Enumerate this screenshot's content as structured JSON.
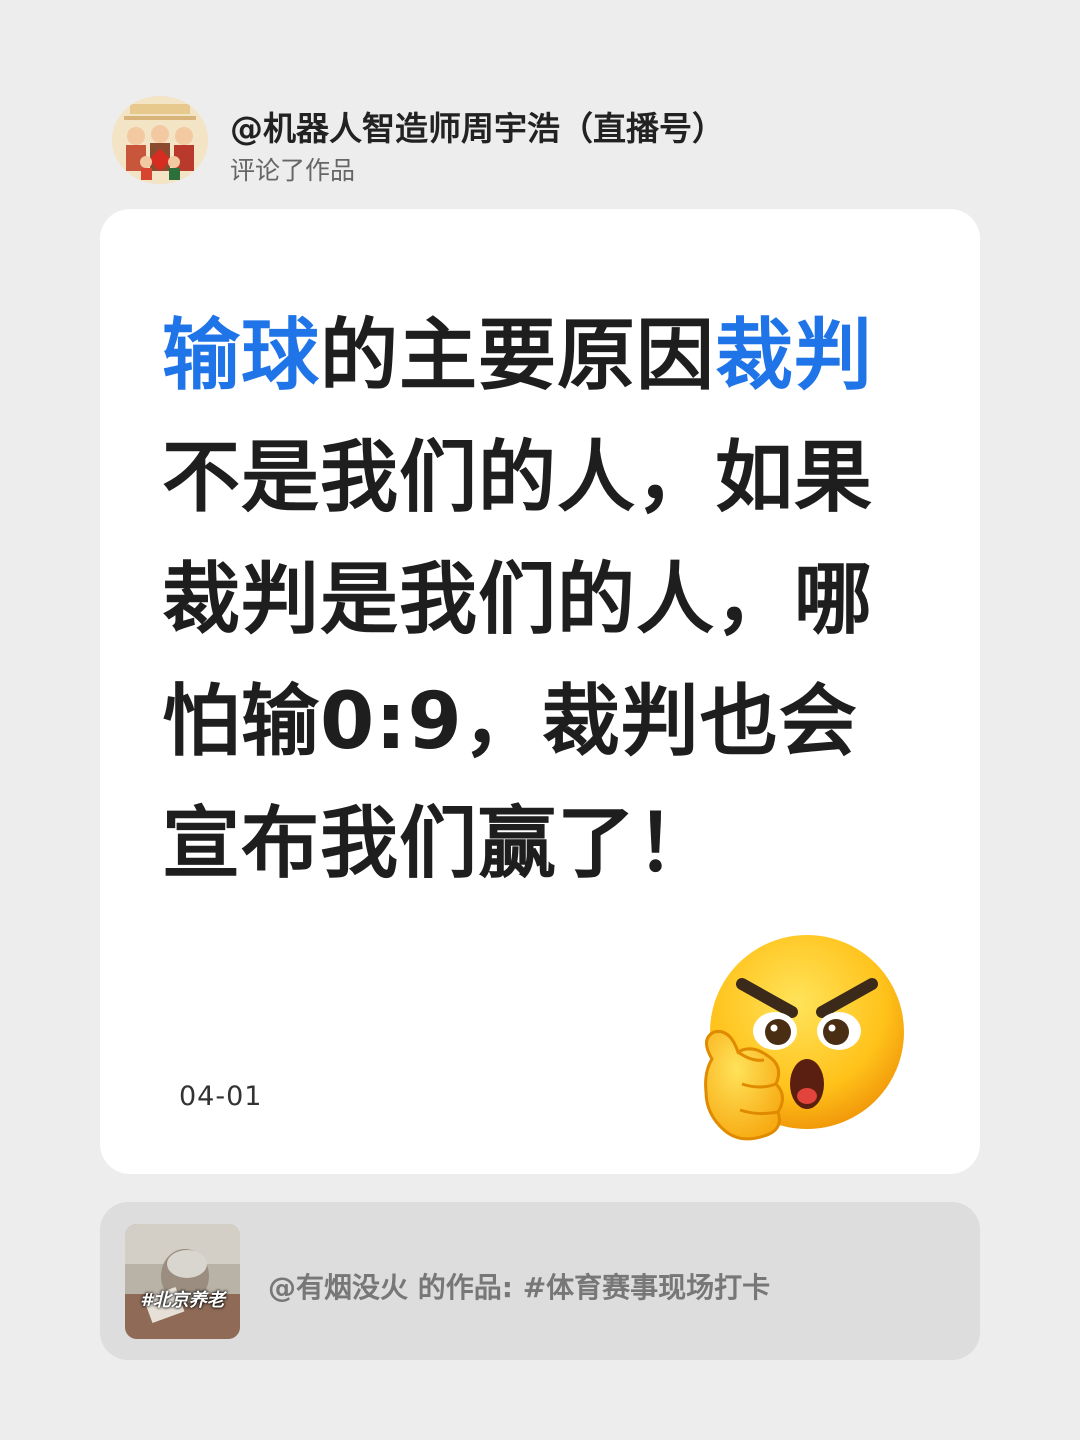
{
  "header": {
    "username": "@机器人智造师周宇浩（直播号）",
    "action": "评论了作品",
    "avatar_icon": "family-portrait-avatar"
  },
  "comment": {
    "segments": [
      {
        "text": "输球",
        "highlight": true
      },
      {
        "text": "的主要原因",
        "highlight": false
      },
      {
        "text": "裁判",
        "highlight": true
      },
      {
        "text": "不是我们的人，如果裁判是我们的人，哪怕输0:9，裁判也会宣布我们赢了！",
        "highlight": false
      }
    ],
    "highlight_color": "#1f74e8",
    "date": "04-01",
    "emoji_icon": "angry-thinking-face-icon"
  },
  "reference": {
    "text": "@有烟没火 的作品: #体育赛事现场打卡",
    "thumbnail_tag": "#北京养老",
    "thumbnail_icon": "elderly-person-photo"
  }
}
